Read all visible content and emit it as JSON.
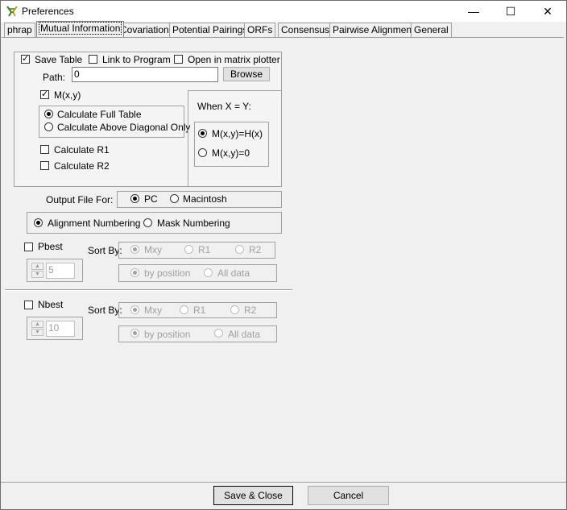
{
  "window": {
    "title": "Preferences",
    "controls": {
      "minimize": "—",
      "maximize": "☐",
      "close": "✕"
    }
  },
  "tabs": [
    {
      "label": "phrap"
    },
    {
      "label": "Mutual Information",
      "selected": true
    },
    {
      "label": "Covariation"
    },
    {
      "label": "Potential Pairings"
    },
    {
      "label": "ORFs"
    },
    {
      "label": "Consensus"
    },
    {
      "label": "Pairwise Alignment"
    },
    {
      "label": "General"
    }
  ],
  "save_table": {
    "save_label": "Save Table",
    "save_checked": true,
    "link_label": "Link to Program",
    "link_checked": false,
    "matrix_label": "Open in matrix plotter",
    "matrix_checked": false,
    "path_label": "Path:",
    "path_value": "0",
    "browse_label": "Browse"
  },
  "mxy": {
    "label": "M(x,y)",
    "checked": true,
    "full_label": "Calculate Full Table",
    "above_label": "Calculate Above Diagonal Only",
    "r1_label": "Calculate R1",
    "r2_label": "Calculate R2"
  },
  "when_x_eq_y": {
    "title": "When X = Y:",
    "opt1": "M(x,y)=H(x)",
    "opt2": "M(x,y)=0"
  },
  "output": {
    "label": "Output File For:",
    "pc": "PC",
    "mac": "Macintosh"
  },
  "numbering": {
    "alignment": "Alignment Numbering",
    "mask": "Mask Numbering"
  },
  "pbest": {
    "label": "Pbest",
    "sort_by": "Sort By:",
    "mxy": "Mxy",
    "r1": "R1",
    "r2": "R2",
    "by_position": "by position",
    "all_data": "All data",
    "value": "5"
  },
  "nbest": {
    "label": "Nbest",
    "sort_by": "Sort By:",
    "mxy": "Mxy",
    "r1": "R1",
    "r2": "R2",
    "by_position": "by position",
    "all_data": "All data",
    "value": "10"
  },
  "footer": {
    "save_close": "Save & Close",
    "cancel": "Cancel"
  }
}
